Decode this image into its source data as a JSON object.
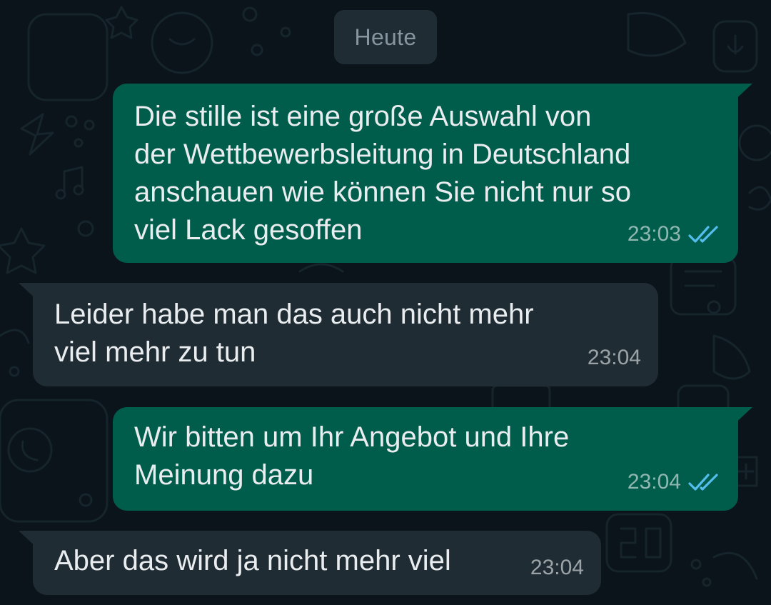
{
  "chat": {
    "date_label": "Heute",
    "colors": {
      "background": "#0b141a",
      "outgoing_bubble": "#005c4b",
      "incoming_bubble": "#1f2c33",
      "read_ticks": "#53bdeb"
    },
    "messages": [
      {
        "direction": "outgoing",
        "lines": [
          "Die stille ist eine große Auswahl von",
          "der Wettbewerbsleitung in Deutschland",
          "anschauen wie können Sie nicht nur so",
          "viel Lack gesoffen"
        ],
        "time": "23:03",
        "status_icon": "double-check-read-icon"
      },
      {
        "direction": "incoming",
        "lines": [
          "Leider habe man das auch nicht mehr",
          "viel mehr zu tun"
        ],
        "time": "23:04"
      },
      {
        "direction": "outgoing",
        "lines": [
          "Wir bitten um Ihr Angebot und Ihre",
          "Meinung dazu"
        ],
        "time": "23:04",
        "status_icon": "double-check-read-icon"
      },
      {
        "direction": "incoming",
        "lines": [
          "Aber das wird ja nicht mehr viel"
        ],
        "time": "23:04"
      }
    ]
  }
}
